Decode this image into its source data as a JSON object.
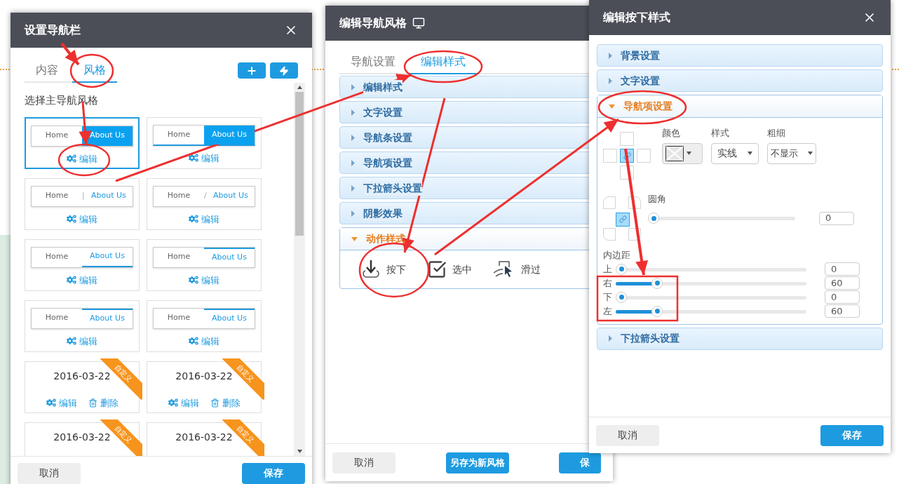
{
  "nav_dialog": {
    "title": "设置导航栏",
    "tabs": [
      {
        "label": "内容",
        "selected": false
      },
      {
        "label": "风格",
        "selected": true
      }
    ],
    "section_title": "选择主导航风格",
    "styles": [
      {
        "kind": "filled",
        "home": "Home",
        "about": "About Us",
        "edit": "编辑",
        "selected": true
      },
      {
        "kind": "filled-underline",
        "home": "Home",
        "about": "About Us",
        "edit": "编辑",
        "selected": false
      },
      {
        "kind": "separator",
        "home": "Home",
        "separator": "|",
        "about": "About Us",
        "edit": "编辑",
        "selected": false
      },
      {
        "kind": "separator",
        "home": "Home",
        "separator": "/",
        "about": "About Us",
        "edit": "编辑",
        "selected": false
      },
      {
        "kind": "underline",
        "home": "Home",
        "about": "About Us",
        "edit": "编辑",
        "selected": false
      },
      {
        "kind": "overline",
        "home": "Home",
        "about": "About Us",
        "edit": "编辑",
        "selected": false
      },
      {
        "kind": "overline",
        "home": "Home",
        "about": "About Us",
        "edit": "编辑",
        "selected": false
      },
      {
        "kind": "overline",
        "home": "Home",
        "about": "About Us",
        "edit": "编辑",
        "selected": false
      },
      {
        "kind": "custom",
        "date": "2016-03-22",
        "ribbon": "自定义",
        "edit": "编辑",
        "delete": "删除",
        "selected": false
      },
      {
        "kind": "custom",
        "date": "2016-03-22",
        "ribbon": "自定义",
        "edit": "编辑",
        "delete": "删除",
        "selected": false
      },
      {
        "kind": "custom",
        "date": "2016-03-22",
        "ribbon": "自定义",
        "selected": false
      },
      {
        "kind": "custom",
        "date": "2016-03-22",
        "ribbon": "自定义",
        "selected": false
      }
    ],
    "cancel": "取消",
    "save": "保存"
  },
  "style_dialog": {
    "title": "编辑导航风格",
    "tabs": [
      {
        "label": "导航设置",
        "selected": false
      },
      {
        "label": "编辑样式",
        "selected": true
      }
    ],
    "sections": [
      {
        "label": "编辑样式",
        "expanded": false
      },
      {
        "label": "文字设置",
        "expanded": false
      },
      {
        "label": "导航条设置",
        "expanded": false
      },
      {
        "label": "导航项设置",
        "expanded": false
      },
      {
        "label": "下拉箭头设置",
        "expanded": false
      },
      {
        "label": "阴影效果",
        "expanded": false
      },
      {
        "label": "动作样式",
        "expanded": true
      }
    ],
    "actions": [
      {
        "kind": "press",
        "label": "按下"
      },
      {
        "kind": "select",
        "label": "选中"
      },
      {
        "kind": "hover",
        "label": "滑过"
      }
    ],
    "cancel": "取消",
    "save_as": "另存为新风格",
    "save": "保"
  },
  "press_dialog": {
    "title": "编辑按下样式",
    "sections": [
      {
        "label": "背景设置",
        "expanded": false
      },
      {
        "label": "文字设置",
        "expanded": false
      },
      {
        "label": "导航项设置",
        "expanded": true
      },
      {
        "label": "下拉箭头设置",
        "expanded": false
      }
    ],
    "border": {
      "linked": true,
      "color_label": "颜色",
      "style_label": "样式",
      "style_value": "实线",
      "weight_label": "粗细",
      "weight_value": "不显示"
    },
    "radius": {
      "linked": true,
      "label": "圆角",
      "level": 0,
      "value": "0"
    },
    "padding": {
      "label": "内边距",
      "rows": [
        {
          "label": "上",
          "level": 0,
          "value": "0"
        },
        {
          "label": "右",
          "level": 0.2,
          "value": "60"
        },
        {
          "label": "下",
          "level": 0,
          "value": "0"
        },
        {
          "label": "左",
          "level": 0.2,
          "value": "60"
        }
      ]
    },
    "cancel": "取消",
    "save": "保存"
  }
}
